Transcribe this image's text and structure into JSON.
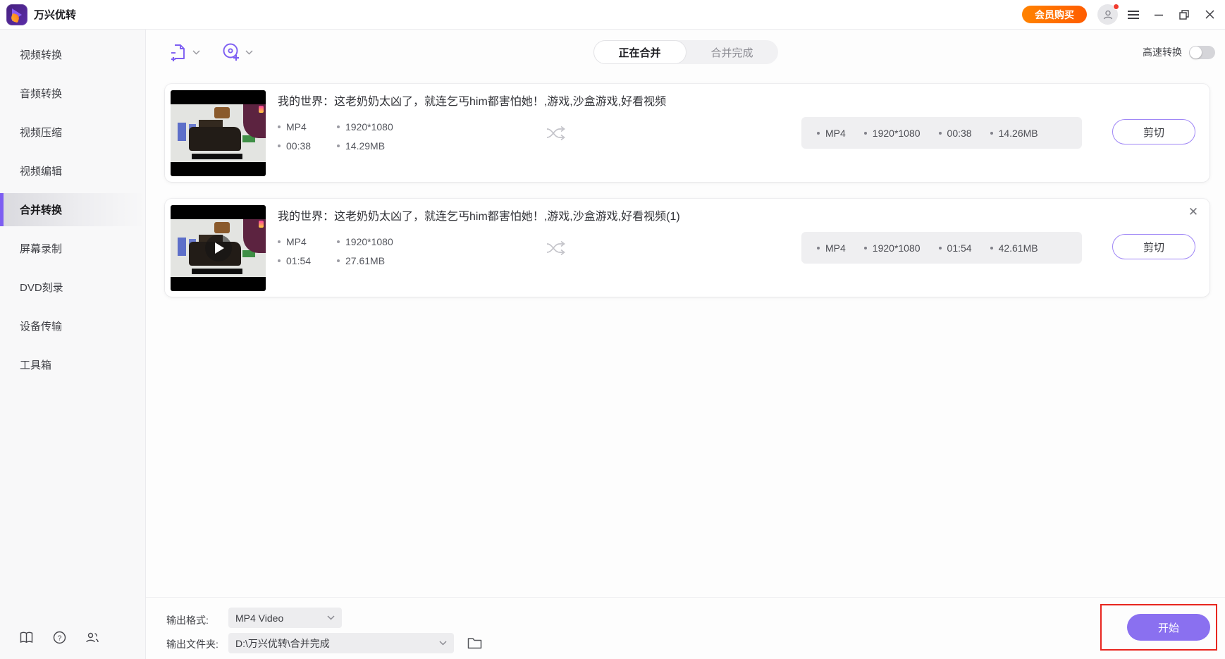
{
  "window": {
    "app_title": "万兴优转",
    "vip_button": "会员购买"
  },
  "sidebar": {
    "items": [
      {
        "label": "视频转换",
        "active": false
      },
      {
        "label": "音频转换",
        "active": false
      },
      {
        "label": "视频压缩",
        "active": false
      },
      {
        "label": "视频编辑",
        "active": false
      },
      {
        "label": "合并转换",
        "active": true
      },
      {
        "label": "屏幕录制",
        "active": false
      },
      {
        "label": "DVD刻录",
        "active": false
      },
      {
        "label": "设备传输",
        "active": false
      },
      {
        "label": "工具箱",
        "active": false
      }
    ]
  },
  "toolbar": {
    "tab_merging": "正在合并",
    "tab_merged": "合并完成",
    "highspeed_label": "高速转换",
    "highspeed_enabled": false
  },
  "list": {
    "items": [
      {
        "title": "我的世界：这老奶奶太凶了，就连乞丐him都害怕她！,游戏,沙盒游戏,好看视频",
        "source": {
          "format": "MP4",
          "resolution": "1920*1080",
          "duration": "00:38",
          "size": "14.29MB"
        },
        "output": {
          "format": "MP4",
          "resolution": "1920*1080",
          "duration": "00:38",
          "size": "14.26MB"
        },
        "action_label": "剪切"
      },
      {
        "title": "我的世界：这老奶奶太凶了，就连乞丐him都害怕她！,游戏,沙盒游戏,好看视频(1)",
        "source": {
          "format": "MP4",
          "resolution": "1920*1080",
          "duration": "01:54",
          "size": "27.61MB"
        },
        "output": {
          "format": "MP4",
          "resolution": "1920*1080",
          "duration": "01:54",
          "size": "42.61MB"
        },
        "action_label": "剪切"
      }
    ]
  },
  "footer": {
    "format_label": "输出格式:",
    "format_value": "MP4 Video",
    "folder_label": "输出文件夹:",
    "folder_value": "D:\\万兴优转\\合并完成",
    "start_button": "开始"
  },
  "colors": {
    "accent_purple": "#7d5ef2",
    "vip_orange": "#ff6a00",
    "annotation_red": "#e8261f"
  }
}
